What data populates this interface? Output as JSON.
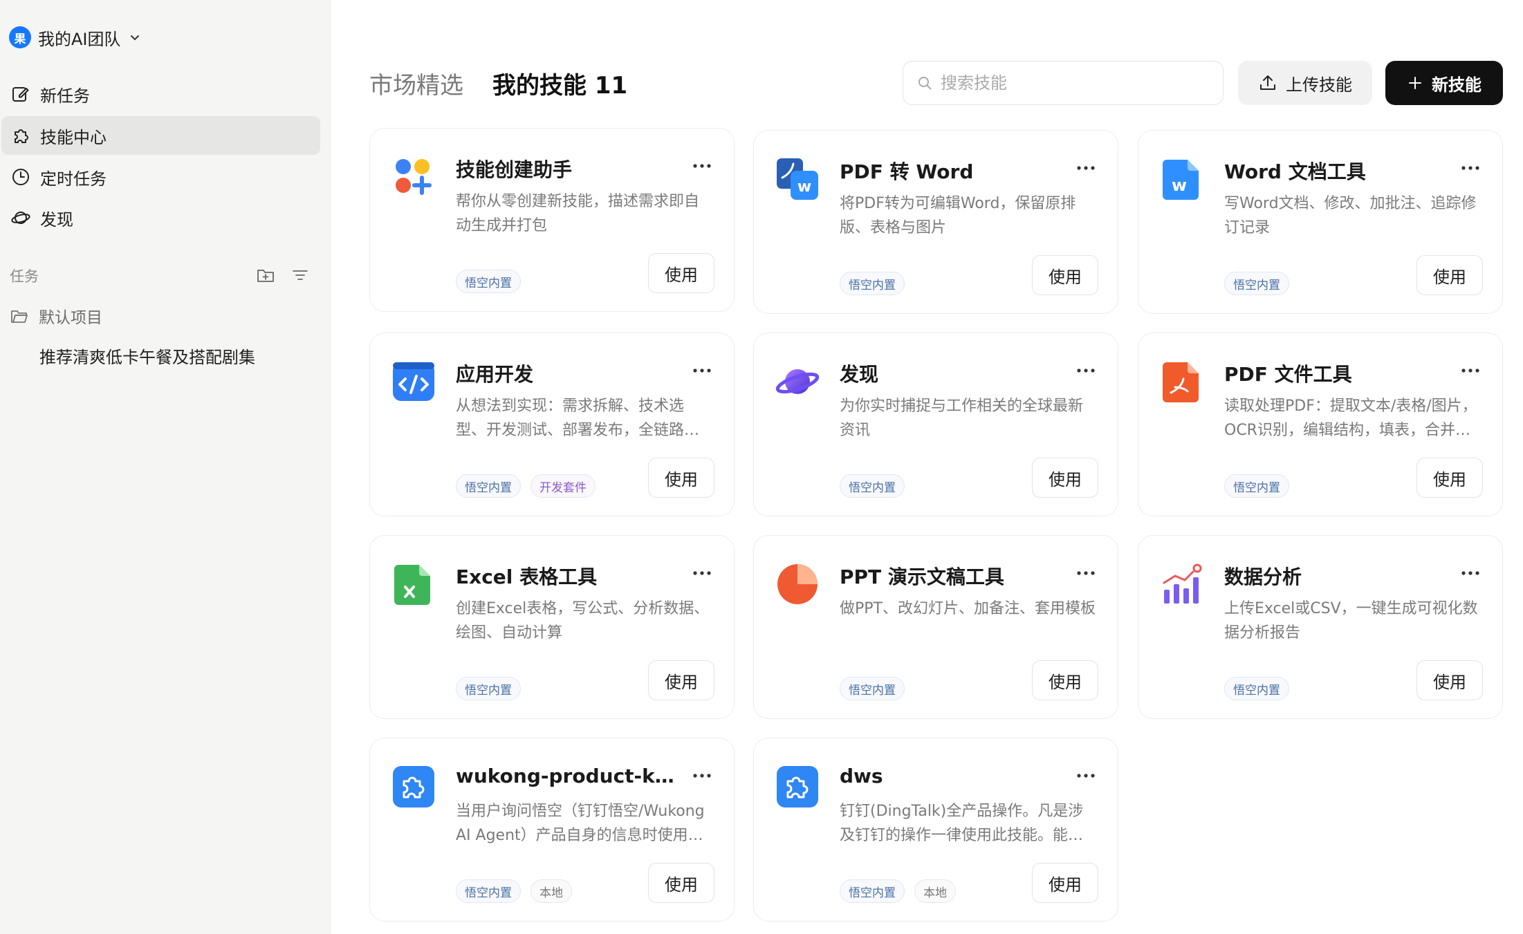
{
  "sidebar": {
    "team_logo": "果",
    "team_name": "我的AI团队",
    "nav": [
      {
        "label": "新任务",
        "icon": "edit-icon"
      },
      {
        "label": "技能中心",
        "icon": "puzzle-icon",
        "active": true
      },
      {
        "label": "定时任务",
        "icon": "clock-icon"
      },
      {
        "label": "发现",
        "icon": "planet-icon"
      }
    ],
    "tasks_label": "任务",
    "project_name": "默认项目",
    "task_item": "推荐清爽低卡午餐及搭配剧集"
  },
  "header": {
    "tab_market": "市场精选",
    "tab_mine": "我的技能 11",
    "search_placeholder": "搜索技能",
    "upload_label": "上传技能",
    "new_label": "新技能"
  },
  "use_label": "使用",
  "cards": [
    {
      "title": "技能创建助手",
      "desc": "帮你从零创建新技能，描述需求即自动生成并打包",
      "icon": "skill-creator-icon",
      "tags": [
        "悟空内置"
      ]
    },
    {
      "title": "PDF 转 Word",
      "desc": "将PDF转为可编辑Word，保留原排版、表格与图片",
      "icon": "pdf-to-word-icon",
      "tags": [
        "悟空内置"
      ]
    },
    {
      "title": "Word 文档工具",
      "desc": "写Word文档、修改、加批注、追踪修订记录",
      "icon": "word-doc-icon",
      "tags": [
        "悟空内置"
      ]
    },
    {
      "title": "应用开发",
      "desc": "从想法到实现：需求拆解、技术选型、开发测试、部署发布，全链路交付",
      "icon": "code-app-icon",
      "tags": [
        "悟空内置",
        "开发套件"
      ]
    },
    {
      "title": "发现",
      "desc": "为你实时捕捉与工作相关的全球最新资讯",
      "icon": "planet-icon",
      "tags": [
        "悟空内置"
      ]
    },
    {
      "title": "PDF 文件工具",
      "desc": "读取处理PDF：提取文本/表格/图片，OCR识别，编辑结构，填表，合并拆分",
      "icon": "pdf-file-icon",
      "tags": [
        "悟空内置"
      ]
    },
    {
      "title": "Excel 表格工具",
      "desc": "创建Excel表格，写公式、分析数据、绘图、自动计算",
      "icon": "excel-file-icon",
      "tags": [
        "悟空内置"
      ]
    },
    {
      "title": "PPT 演示文稿工具",
      "desc": "做PPT、改幻灯片、加备注、套用模板",
      "icon": "ppt-pie-icon",
      "tags": [
        "悟空内置"
      ]
    },
    {
      "title": "数据分析",
      "desc": "上传Excel或CSV，一键生成可视化数据分析报告",
      "icon": "bar-chart-icon",
      "tags": [
        "悟空内置"
      ]
    },
    {
      "title": "wukong-product-knowledge",
      "desc": "当用户询问悟空（钉钉悟空/Wukong AI Agent）产品自身的信息时使用此技能",
      "icon": "puzzle-blue-icon",
      "tags": [
        "悟空内置",
        "本地"
      ]
    },
    {
      "title": "dws",
      "desc": "钉钉(DingTalk)全产品操作。凡是涉及钉钉的操作一律使用此技能。能力覆盖消息、日程、待办等",
      "icon": "puzzle-blue-icon",
      "tags": [
        "悟空内置",
        "本地"
      ]
    }
  ]
}
